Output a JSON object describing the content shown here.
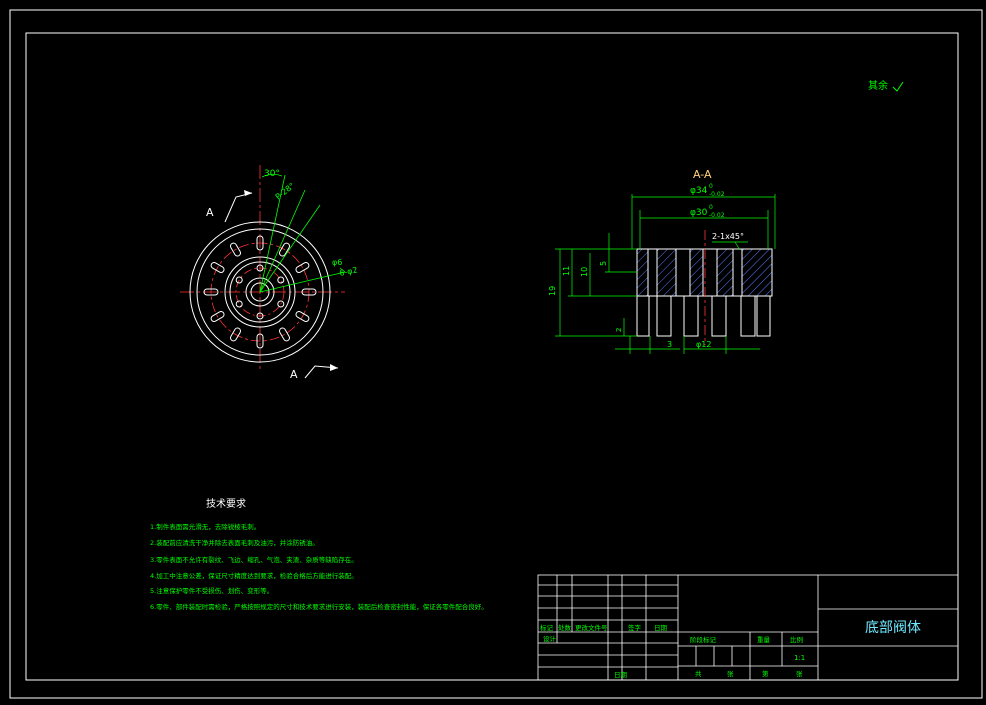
{
  "colors": {
    "background": "#000000",
    "frame": "#ffffff",
    "dimension": "#00ff00",
    "centerline": "#ff3333",
    "hatch": "#5b7cff",
    "section_label": "#ffd27a",
    "title": "#6ee7ff"
  },
  "roughness_note": "其余",
  "front_view": {
    "section_marker": "A",
    "section_marker_bottom": "A",
    "angle_label": "30°",
    "pitch_label": "P-28°",
    "hole_label": "φ6",
    "hole_count_label": "6-φ2"
  },
  "section_view": {
    "title": "A-A",
    "dims": {
      "d34": "φ34",
      "d34_tol_upper": "0",
      "d34_tol_lower": "-0.02",
      "d30": "φ30",
      "d30_tol_upper": "0",
      "d30_tol_lower": "-0.02",
      "chamfer": "2-1x45°",
      "h19": "19",
      "h11": "11",
      "h10": "10",
      "h5": "5",
      "h2": "2",
      "w3": "3",
      "d12": "φ12"
    }
  },
  "tech_requirements": {
    "heading": "技术要求",
    "items": [
      "1.制件表面需光滑无，去除锐棱毛刺。",
      "2.装配前应清洗干净并除去表面毛刺及油污，并涂防锈油。",
      "3.零件表面不允许有裂纹、飞边、缩孔、气泡、夹渣、杂质等缺陷存在。",
      "4.加工中注意公差，保证尺寸精度达到要求，检验合格后方能进行装配。",
      "5.注意保护零件不受损伤、划伤、变形等。",
      "6.零件、部件装配时需检验，严格按照规定的尺寸和技术要求进行安装，装配后检查密封性能，保证各零件配合良好。"
    ]
  },
  "title_block": {
    "part_name": "底部阀体",
    "scale": "1:1",
    "row_labels_1": [
      "标记",
      "处数",
      "更改文件号",
      "签字",
      "日期"
    ],
    "row_labels_2": [
      "设计",
      "审核",
      "工艺",
      "批准"
    ],
    "stage_labels": [
      "阶段标记",
      "重量",
      "比例"
    ],
    "sheet_labels": [
      "共",
      "张",
      "第",
      "张"
    ],
    "date_label": "日期"
  }
}
